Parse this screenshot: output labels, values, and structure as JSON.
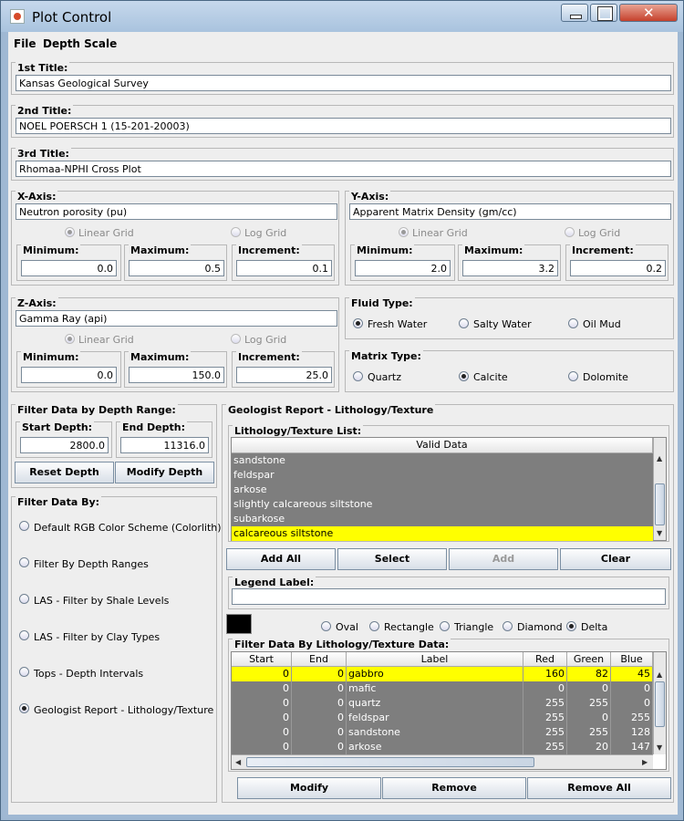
{
  "window": {
    "title": "Plot Control"
  },
  "menu": [
    "File",
    "Depth Scale"
  ],
  "titles": [
    {
      "label": "1st Title:",
      "value": "Kansas Geological Survey"
    },
    {
      "label": "2nd Title:",
      "value": "NOEL POERSCH 1 (15-201-20003)"
    },
    {
      "label": "3rd Title:",
      "value": "Rhomaa-NPHI Cross Plot"
    }
  ],
  "xaxis": {
    "label": "X-Axis:",
    "value": "Neutron porosity (pu)",
    "linear": "Linear Grid",
    "log": "Log Grid",
    "min_label": "Minimum:",
    "max_label": "Maximum:",
    "inc_label": "Increment:",
    "min": "0.0",
    "max": "0.5",
    "inc": "0.1"
  },
  "yaxis": {
    "label": "Y-Axis:",
    "value": "Apparent Matrix Density (gm/cc)",
    "linear": "Linear Grid",
    "log": "Log Grid",
    "min_label": "Minimum:",
    "max_label": "Maximum:",
    "inc_label": "Increment:",
    "min": "2.0",
    "max": "3.2",
    "inc": "0.2"
  },
  "zaxis": {
    "label": "Z-Axis:",
    "value": "Gamma Ray (api)",
    "linear": "Linear Grid",
    "log": "Log Grid",
    "min_label": "Minimum:",
    "max_label": "Maximum:",
    "inc_label": "Increment:",
    "min": "0.0",
    "max": "150.0",
    "inc": "25.0"
  },
  "fluid": {
    "label": "Fluid Type:",
    "options": [
      "Fresh Water",
      "Salty Water",
      "Oil Mud"
    ],
    "selected": "Fresh Water"
  },
  "matrix": {
    "label": "Matrix Type:",
    "options": [
      "Quartz",
      "Calcite",
      "Dolomite"
    ],
    "selected": "Calcite"
  },
  "depth": {
    "label": "Filter Data by Depth Range:",
    "start_label": "Start Depth:",
    "end_label": "End Depth:",
    "start": "2800.0",
    "end": "11316.0",
    "reset": "Reset Depth",
    "modify": "Modify Depth"
  },
  "filterby": {
    "label": "Filter Data By:",
    "options": [
      "Default RGB Color Scheme (Colorlith)",
      "Filter By Depth Ranges",
      "LAS - Filter by Shale Levels",
      "LAS - Filter by Clay Types",
      "Tops - Depth Intervals",
      "Geologist Report - Lithology/Texture"
    ],
    "selected": "Geologist Report - Lithology/Texture"
  },
  "geo": {
    "label": "Geologist Report - Lithology/Texture",
    "list_label": "Lithology/Texture List:",
    "list_header": "Valid Data",
    "items": [
      "sandstone",
      "feldspar",
      "arkose",
      "slightly calcareous siltstone",
      "subarkose",
      "calcareous siltstone"
    ],
    "selected": "calcareous siltstone",
    "add_all": "Add All",
    "select": "Select",
    "add": "Add",
    "clear": "Clear",
    "legend_label": "Legend Label:",
    "legend_value": "",
    "swatch_color": "#000000",
    "shapes": [
      "Oval",
      "Rectangle",
      "Triangle",
      "Diamond",
      "Delta"
    ],
    "shape_selected": "Delta",
    "table_label": "Filter Data By Lithology/Texture Data:",
    "columns": [
      "Start",
      "End",
      "Label",
      "Red",
      "Green",
      "Blue"
    ],
    "rows": [
      [
        "0",
        "0",
        "gabbro",
        "160",
        "82",
        "45"
      ],
      [
        "0",
        "0",
        "mafic",
        "0",
        "0",
        "0"
      ],
      [
        "0",
        "0",
        "quartz",
        "255",
        "255",
        "0"
      ],
      [
        "0",
        "0",
        "feldspar",
        "255",
        "0",
        "255"
      ],
      [
        "0",
        "0",
        "sandstone",
        "255",
        "255",
        "128"
      ],
      [
        "0",
        "0",
        "arkose",
        "255",
        "20",
        "147"
      ]
    ],
    "modify": "Modify",
    "remove": "Remove",
    "remove_all": "Remove All"
  }
}
